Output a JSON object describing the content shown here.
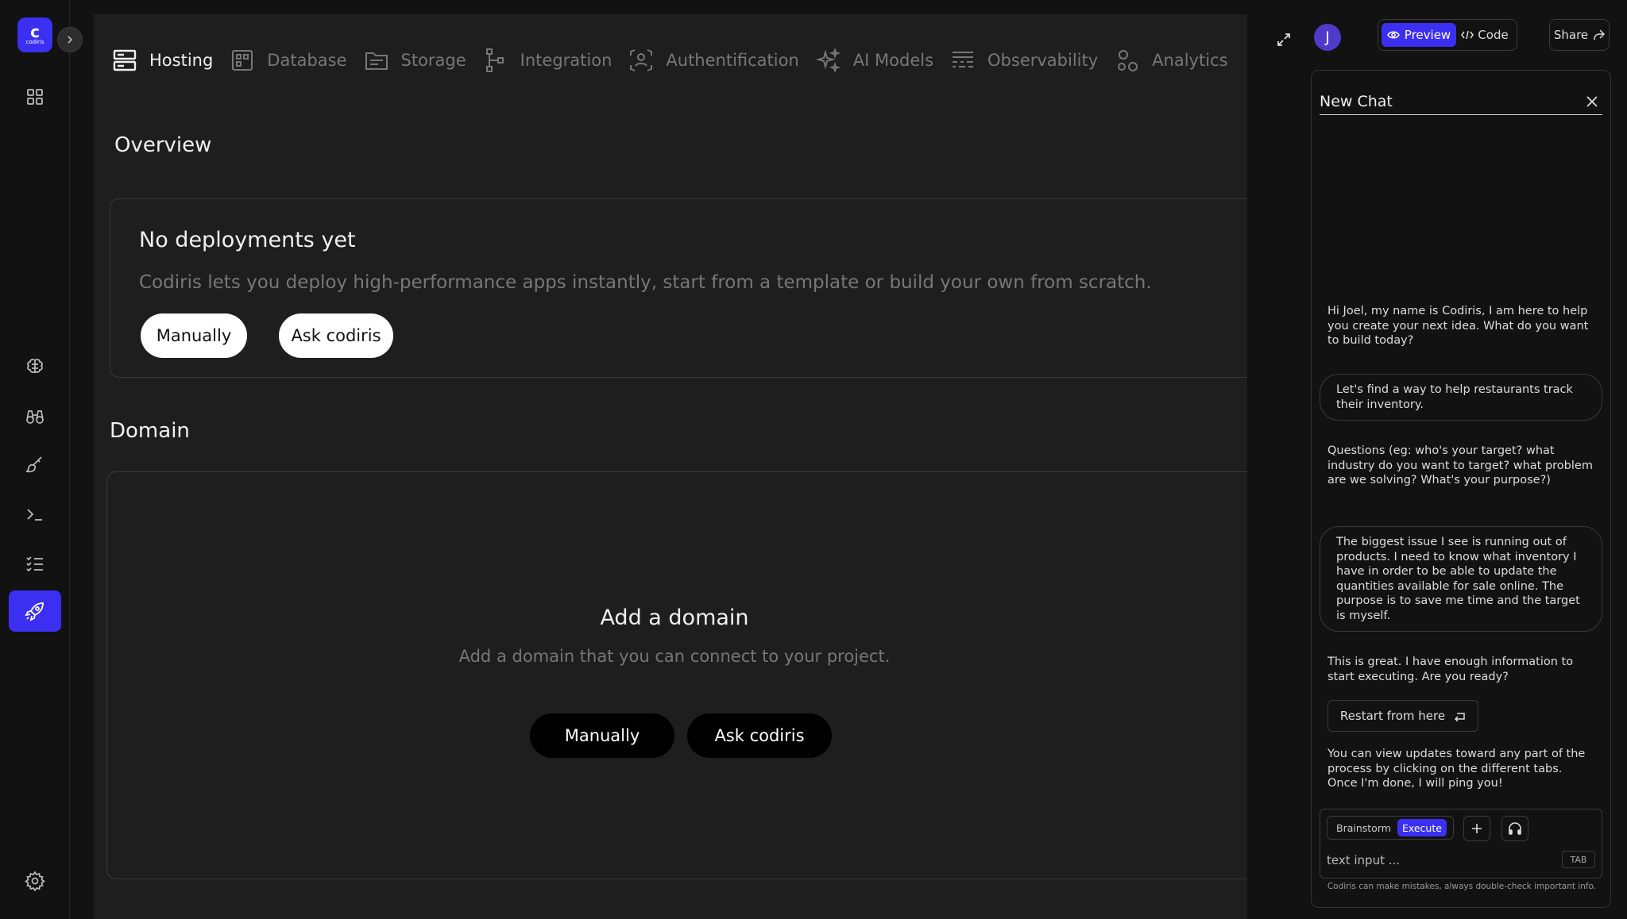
{
  "brand": {
    "logo_glyph": "c",
    "logo_word": "codiris",
    "color": "#3b2ff2"
  },
  "tabs": [
    {
      "label": "Hosting",
      "icon": "server-icon",
      "active": true
    },
    {
      "label": "Database",
      "icon": "database-icon"
    },
    {
      "label": "Storage",
      "icon": "folder-icon"
    },
    {
      "label": "Integration",
      "icon": "integration-icon"
    },
    {
      "label": "Authentification",
      "icon": "user-scan-icon"
    },
    {
      "label": "AI Models",
      "icon": "sparkles-icon"
    },
    {
      "label": "Observability",
      "icon": "chart-icon"
    },
    {
      "label": "Analytics",
      "icon": "analytics-icon"
    }
  ],
  "overview": {
    "title": "Overview",
    "card_title": "No deployments yet",
    "card_text": "Codiris lets you deploy high-performance apps instantly, start from a template or build your own from scratch.",
    "btn_manual": "Manually",
    "btn_ask": "Ask codiris"
  },
  "domain": {
    "title": "Domain",
    "heading": "Add a domain",
    "text": "Add a domain that you can connect to your project.",
    "btn_manual": "Manually",
    "btn_ask": "Ask codiris"
  },
  "header": {
    "avatar_letter": "J",
    "preview_label": "Preview",
    "code_label": "Code",
    "share_label": "Share"
  },
  "chat": {
    "title": "New Chat",
    "messages": [
      "Hi Joel, my name is Codiris, I am here to help you create your next idea. What do you want to build today?",
      "Let's find a way to help restaurants track their inventory.",
      "Questions (eg: who's your target? what industry do you want to target? what problem are we solving? What's your purpose?)",
      "The biggest issue I see is running out of products. I need to know what inventory I have in order to be able to update the quantities available for sale online. The purpose is to save me time and the target is myself.",
      "This is great. I have enough information to start executing. Are you ready?",
      "You can view updates toward any part of the process by clicking on the different tabs. Once I'm done, I will ping you!"
    ],
    "restart_label": "Restart from here",
    "mode_brainstorm": "Brainstorm",
    "mode_execute": "Execute",
    "input_placeholder": "text input ...",
    "tab_key": "TAB",
    "disclaimer": "Codiris can make mistakes, always double-check important info."
  }
}
